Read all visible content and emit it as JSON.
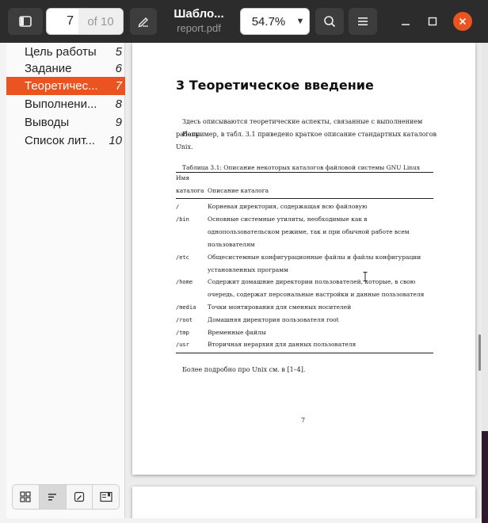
{
  "header": {
    "current_page": "7",
    "page_total": "of 10",
    "title": "Шабло...",
    "filename": "report.pdf",
    "zoom": "54.7%"
  },
  "sidebar": {
    "items": [
      {
        "label": "Цель работы",
        "page": "5"
      },
      {
        "label": "Задание",
        "page": "6"
      },
      {
        "label": "Теоретичес...",
        "page": "7",
        "active": true
      },
      {
        "label": "Выполнени...",
        "page": "8"
      },
      {
        "label": "Выводы",
        "page": "9"
      },
      {
        "label": "Список лит...",
        "page": "10"
      }
    ]
  },
  "document": {
    "heading": "3  Теоретическое введение",
    "para1": "Здесь описываются теоретические аспекты, связанные с выполнением работы.",
    "para2": "Например, в табл. 3.1 приведено краткое описание стандартных каталогов Unix.",
    "table_caption": "Таблица 3.1: Описание некоторых каталогов файловой системы GNU Linux",
    "col1_header_l1": "Имя",
    "col1_header_l2": "каталога",
    "col2_header": "Описание каталога",
    "rows": [
      {
        "dir": "/",
        "desc": [
          "Корневая директория, содержащая всю файловую"
        ]
      },
      {
        "dir": "/bin",
        "desc": [
          "Основные системные утилиты, необходимые как в",
          "однопользовательском режиме, так и при обычной работе всем",
          "пользователям"
        ]
      },
      {
        "dir": "/etc",
        "desc": [
          "Общесистемные конфигурационные файлы и файлы конфигурации",
          "установленных программ"
        ]
      },
      {
        "dir": "/home",
        "desc": [
          "Содержит домашние директории пользователей, которые, в свою",
          "очередь, содержат персональные настройки и данные пользователя"
        ]
      },
      {
        "dir": "/media",
        "desc": [
          "Точки монтирования для сменных носителей"
        ]
      },
      {
        "dir": "/root",
        "desc": [
          "Домашняя директория пользователя root"
        ]
      },
      {
        "dir": "/tmp",
        "desc": [
          "Временные файлы"
        ]
      },
      {
        "dir": "/usr",
        "desc": [
          "Вторичная иерархия для данных пользователя"
        ]
      }
    ],
    "after_table": "Более подробно про Unix см. в [1–4].",
    "page_number": "7"
  },
  "colors": {
    "accent": "#e95420",
    "header_bg": "#2c2c2c"
  },
  "icons": {
    "sidebar_toggle": "sidebar-toggle-icon",
    "annotate": "pencil-icon",
    "search": "search-icon",
    "menu": "hamburger-menu-icon",
    "minimize": "minimize-icon",
    "maximize": "maximize-icon",
    "close": "close-icon",
    "thumbnails": "grid-icon",
    "outline": "outline-icon",
    "annotations": "annotations-icon",
    "bookmarks": "bookmarks-icon"
  }
}
